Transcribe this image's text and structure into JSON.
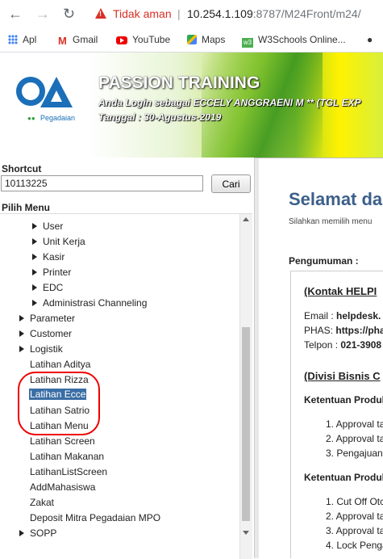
{
  "browser": {
    "security_label": "Tidak aman",
    "separator": "|",
    "url_host": "10.254.1.109",
    "url_path": ":8787/M24Front/m24/",
    "bookmarks": [
      "Apl",
      "Gmail",
      "YouTube",
      "Maps",
      "W3Schools Online..."
    ]
  },
  "banner": {
    "title": "PASSION TRAINING",
    "login_line": "Anda Login sebagai ECCELY ANGGRAENI M ** (TGL EXP",
    "date_line": "Tanggal : 30-Agustus-2019",
    "logo_text": "Pegadaian"
  },
  "sidebar": {
    "shortcut_label": "Shortcut",
    "shortcut_value": "10113225",
    "search_button": "Cari",
    "menu_label": "Pilih Menu",
    "items": [
      {
        "label": "User",
        "expandable": true
      },
      {
        "label": "Unit Kerja",
        "expandable": true
      },
      {
        "label": "Kasir",
        "expandable": true
      },
      {
        "label": "Printer",
        "expandable": true
      },
      {
        "label": "EDC",
        "expandable": true
      },
      {
        "label": "Administrasi Channeling",
        "expandable": true
      },
      {
        "label": "Parameter",
        "expandable": true
      },
      {
        "label": "Customer",
        "expandable": true
      },
      {
        "label": "Logistik",
        "expandable": true
      },
      {
        "label": "Latihan Aditya",
        "expandable": false
      },
      {
        "label": "Latihan Rizza",
        "expandable": false
      },
      {
        "label": "Latihan Ecce",
        "expandable": false,
        "selected": true
      },
      {
        "label": "Latihan Satrio",
        "expandable": false
      },
      {
        "label": "Latihan Menu",
        "expandable": false
      },
      {
        "label": "Latihan Screen",
        "expandable": false
      },
      {
        "label": "Latihan Makanan",
        "expandable": false
      },
      {
        "label": "LatihanListScreen",
        "expandable": false
      },
      {
        "label": "AddMahasiswa",
        "expandable": false
      },
      {
        "label": "Zakat",
        "expandable": false
      },
      {
        "label": "Deposit Mitra Pegadaian MPO",
        "expandable": false
      },
      {
        "label": "SOPP",
        "expandable": true
      }
    ]
  },
  "main": {
    "welcome": "Selamat da",
    "subtitle": "Silahkan memilih menu",
    "announcement_label": "Pengumuman :",
    "contact_heading": "(Kontak HELPI",
    "email_label": "Email :",
    "email_value": "helpdesk.",
    "phas_label": "PHAS:",
    "phas_value": "https://pha",
    "phone_label": "Telpon :",
    "phone_value": "021-3908",
    "division_heading": "(Divisi Bisnis C",
    "provision1_title": "Ketentuan Produl",
    "provision1_items": [
      "1. Approval ta",
      "2. Approval ta",
      "3. Pengajuan"
    ],
    "provision2_title": "Ketentuan Produl",
    "provision2_items": [
      "1. Cut Off Otc",
      "2. Approval ta",
      "3. Approval ta",
      "4. Lock Penga"
    ]
  },
  "colors": {
    "accent_blue": "#3c5f8a",
    "selection": "#3a6ea5",
    "annotation": "#e00000",
    "insecure": "#d93025"
  }
}
